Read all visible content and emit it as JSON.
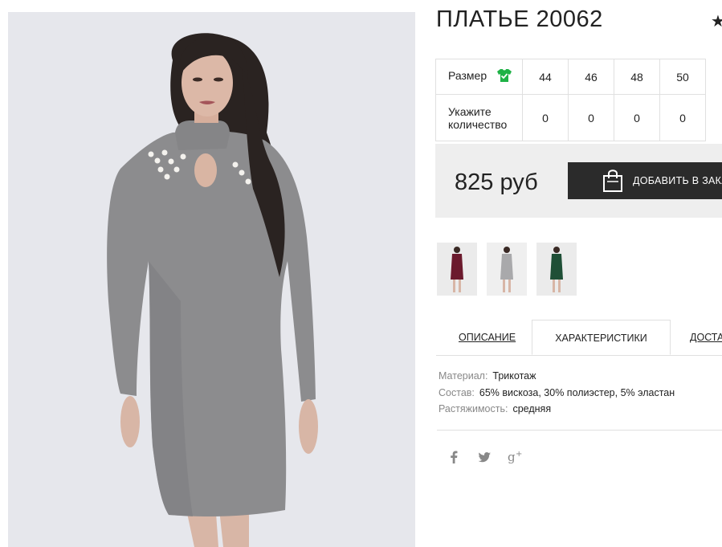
{
  "product": {
    "title": "ПЛАТЬЕ 20062"
  },
  "sizes": {
    "size_label": "Размер",
    "values": [
      "44",
      "46",
      "48",
      "50"
    ],
    "qty_label": "Укажите количество",
    "quantities": [
      "0",
      "0",
      "0",
      "0"
    ]
  },
  "price": {
    "amount": "825 руб"
  },
  "cart": {
    "button_label": "ДОБАВИТЬ В ЗАКАЗ"
  },
  "thumbnails": [
    {
      "color": "#6b1a2d"
    },
    {
      "color": "#a9a9ab"
    },
    {
      "color": "#1f4f36"
    }
  ],
  "tabs": [
    "ОПИСАНИЕ",
    "ХАРАКТЕРИСТИКИ",
    "ДОСТАВКА"
  ],
  "specs": [
    {
      "key": "Материал:",
      "value": "Трикотаж"
    },
    {
      "key": "Состав:",
      "value": "65% вискоза, 30% полиэстер, 5% эластан"
    },
    {
      "key": "Растяжимость:",
      "value": "средняя"
    }
  ],
  "social": [
    "facebook-icon",
    "twitter-icon",
    "google-plus-icon"
  ],
  "colors": {
    "accent": "#2b2b2b",
    "size_icon": "#1fb246",
    "price_bg": "#eeeeee"
  }
}
